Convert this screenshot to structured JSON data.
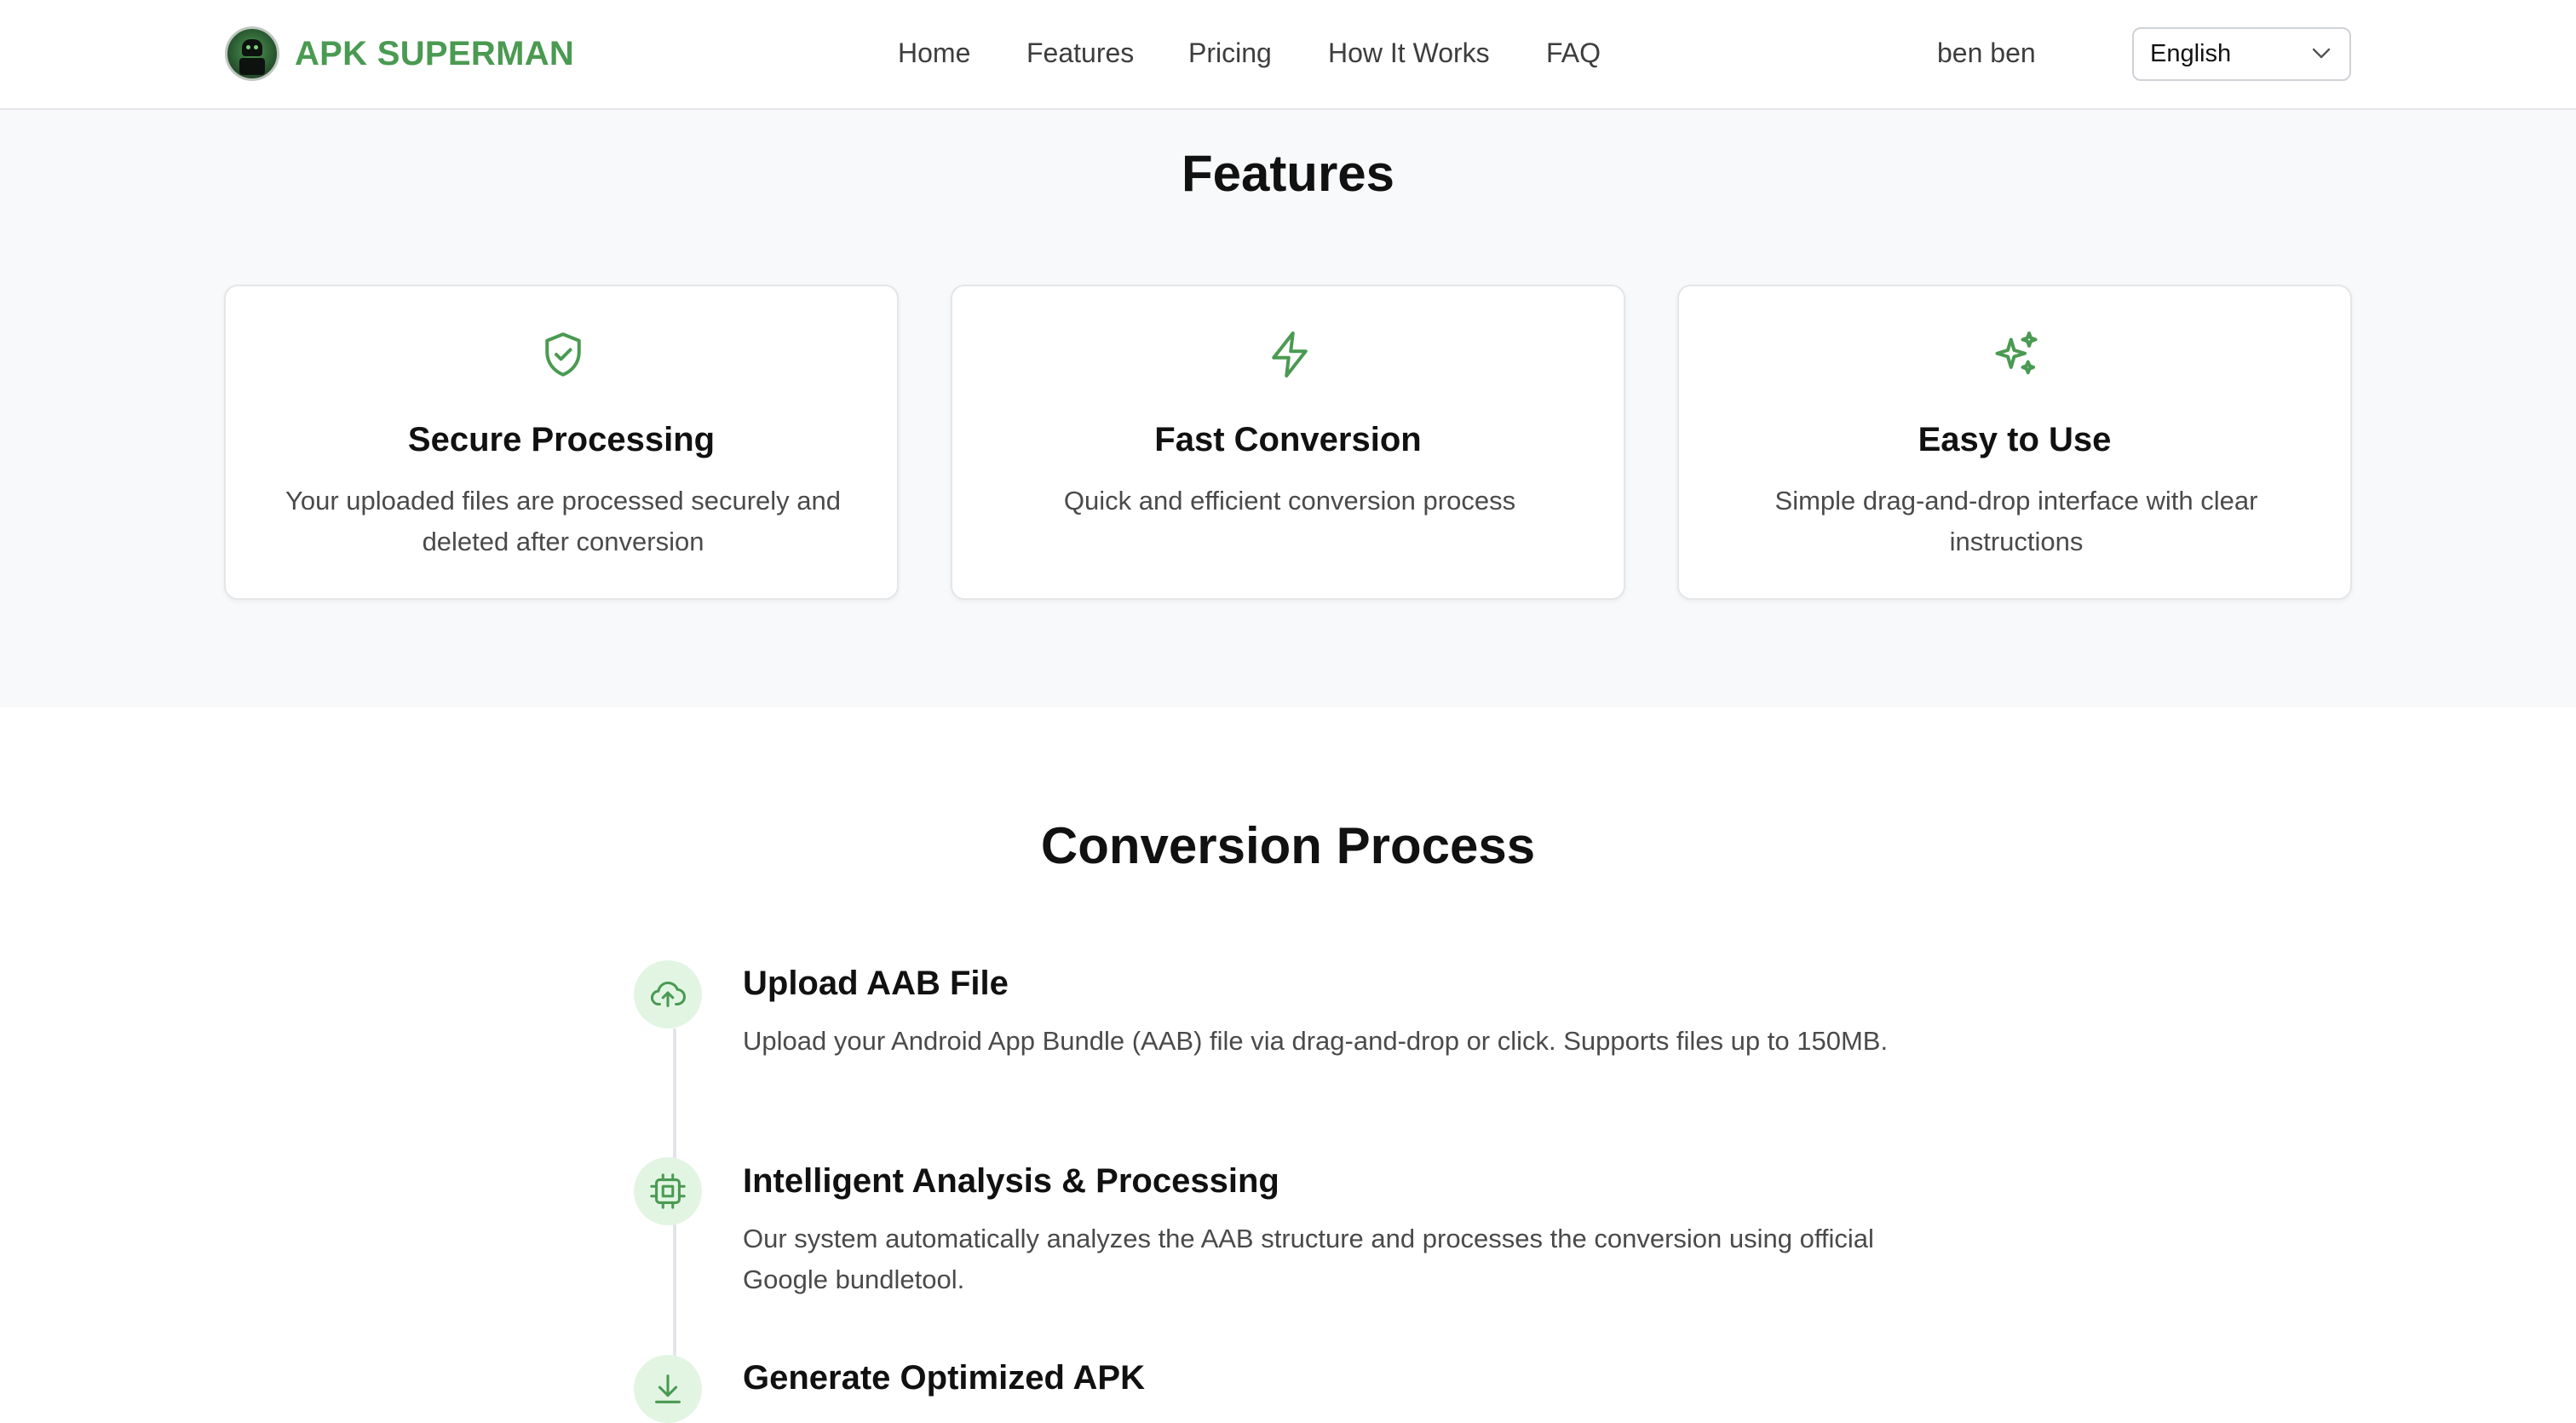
{
  "header": {
    "brand": "APK SUPERMAN",
    "nav": [
      "Home",
      "Features",
      "Pricing",
      "How It Works",
      "FAQ"
    ],
    "user_name": "ben ben",
    "language": "English"
  },
  "features": {
    "title": "Features",
    "cards": [
      {
        "icon": "shield-check-icon",
        "title": "Secure Processing",
        "desc": "Your uploaded files are processed securely and deleted after conversion"
      },
      {
        "icon": "lightning-icon",
        "title": "Fast Conversion",
        "desc": "Quick and efficient conversion process"
      },
      {
        "icon": "sparkles-icon",
        "title": "Easy to Use",
        "desc": "Simple drag-and-drop interface with clear instructions"
      }
    ]
  },
  "process": {
    "title": "Conversion Process",
    "steps": [
      {
        "icon": "cloud-upload-icon",
        "title": "Upload AAB File",
        "desc": "Upload your Android App Bundle (AAB) file via drag-and-drop or click. Supports files up to 150MB."
      },
      {
        "icon": "cpu-icon",
        "title": "Intelligent Analysis & Processing",
        "desc": "Our system automatically analyzes the AAB structure and processes the conversion using official Google bundletool."
      },
      {
        "icon": "download-icon",
        "title": "Generate Optimized APK",
        "desc": ""
      }
    ]
  },
  "colors": {
    "accent": "#4a9a52",
    "icon_bg": "#e2f5e3",
    "section_bg": "#f8f9fa"
  }
}
